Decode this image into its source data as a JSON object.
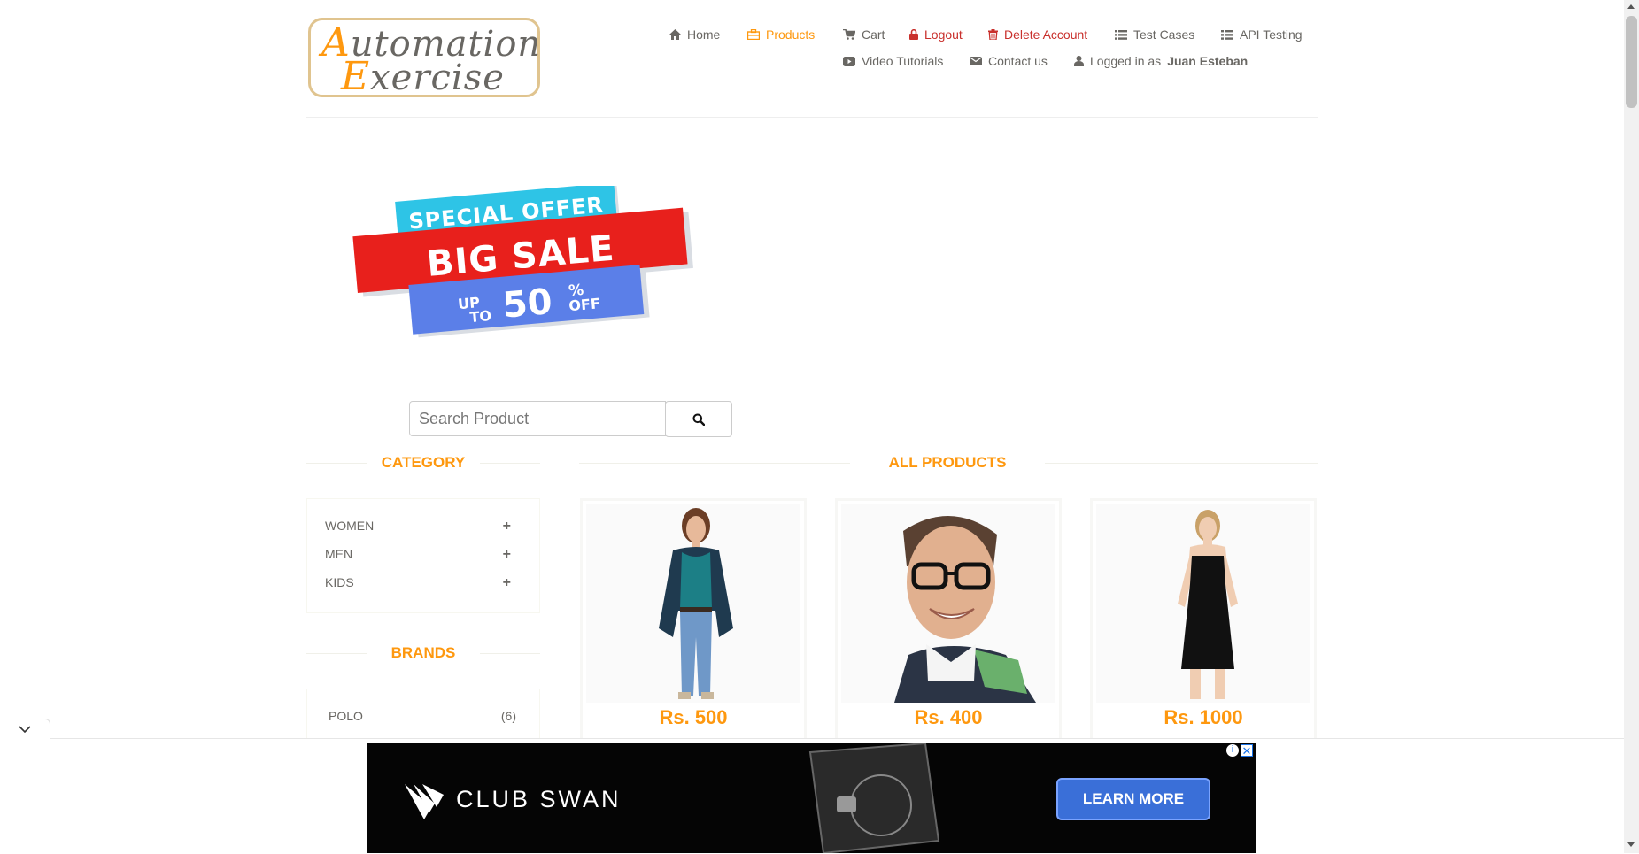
{
  "logo": {
    "line1_first": "A",
    "line1_rest": "utomation",
    "line2_first": "E",
    "line2_rest": "xercise"
  },
  "nav": {
    "home": "Home",
    "products": "Products",
    "cart": "Cart",
    "logout": "Logout",
    "delete_account": "Delete Account",
    "test_cases": "Test Cases",
    "api_testing": "API Testing",
    "video_tutorials": "Video Tutorials",
    "contact_us": "Contact us",
    "logged_in_prefix": "Logged in as",
    "username": "Juan Esteban"
  },
  "banner": {
    "line1": "SPECIAL OFFER",
    "line2": "BIG SALE",
    "up": "UP",
    "to": "TO",
    "percent": "50",
    "pct_sign": "%",
    "off": "OFF"
  },
  "search": {
    "placeholder": "Search Product"
  },
  "sidebar": {
    "category_title": "CATEGORY",
    "categories": [
      {
        "label": "WOMEN",
        "icon": "plus-icon"
      },
      {
        "label": "MEN",
        "icon": "plus-icon"
      },
      {
        "label": "KIDS",
        "icon": "plus-icon"
      }
    ],
    "brands_title": "BRANDS",
    "brands": [
      {
        "label": "POLO",
        "count": "(6)"
      }
    ]
  },
  "main": {
    "title": "ALL PRODUCTS",
    "products": [
      {
        "price": "Rs. 500"
      },
      {
        "price": "Rs. 400"
      },
      {
        "price": "Rs. 1000"
      }
    ]
  },
  "ad": {
    "brand": "CLUB SWAN",
    "cta": "LEARN MORE",
    "close": "✕",
    "info": "i"
  },
  "colors": {
    "accent": "#fe980f",
    "danger": "#c9302c",
    "text": "#696763",
    "ad_button": "#3a6fd8"
  }
}
